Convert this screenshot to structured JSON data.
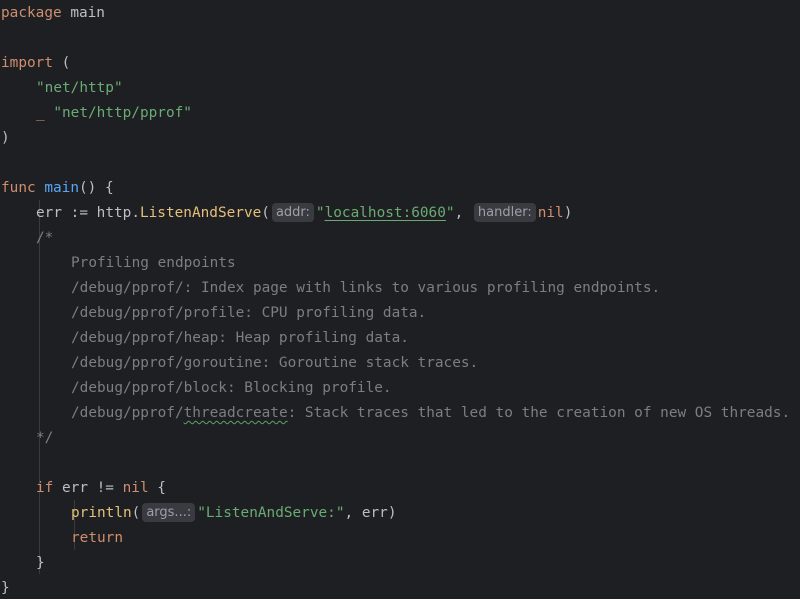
{
  "code": {
    "package_kw": "package",
    "package_name": " main",
    "import_kw": "import",
    "import_open": " (",
    "import1": "\"net/http\"",
    "import2_blank": "_ ",
    "import2": "\"net/http/pprof\"",
    "import_close": ")",
    "func_kw": "func",
    "func_space": " ",
    "func_name": "main",
    "func_sig": "() {",
    "err_decl": "err := ",
    "http_pkg": "http",
    "dot": ".",
    "listen_fn": "ListenAndServe",
    "paren_open": "(",
    "addr_hint": "addr:",
    "addr_q1": "\"",
    "addr_value": "localhost:6060",
    "addr_q2": "\"",
    "comma_space": ", ",
    "handler_hint": "handler:",
    "nil_kw": "nil",
    "paren_close": ")",
    "comment_open": "/*",
    "comment_lines": [
      "Profiling endpoints",
      "/debug/pprof/: Index page with links to various profiling endpoints.",
      "/debug/pprof/profile: CPU profiling data.",
      "/debug/pprof/heap: Heap profiling data.",
      "/debug/pprof/goroutine: Goroutine stack traces.",
      "/debug/pprof/block: Blocking profile."
    ],
    "comment_thread_prefix": "/debug/pprof/",
    "comment_thread_word": "threadcreate",
    "comment_thread_rest": ": Stack traces that led to the creation of new OS threads.",
    "comment_close": "*/",
    "if_kw": "if",
    "if_cond": " err != ",
    "if_nil": "nil",
    "if_brace": " {",
    "println_fn": "println",
    "args_hint": "args...:",
    "println_str": "\"ListenAndServe:\"",
    "println_rest": ", err)",
    "return_kw": "return",
    "inner_close": "}",
    "outer_close": "}"
  },
  "colors": {
    "background": "#1e1f22",
    "keyword": "#cf8e6d",
    "function_decl": "#56a8f5",
    "string": "#6aab73",
    "comment": "#7a7e85",
    "builtin_call": "#e4c07b",
    "text": "#bcbec4",
    "inlay_hint_bg": "#393b40"
  }
}
